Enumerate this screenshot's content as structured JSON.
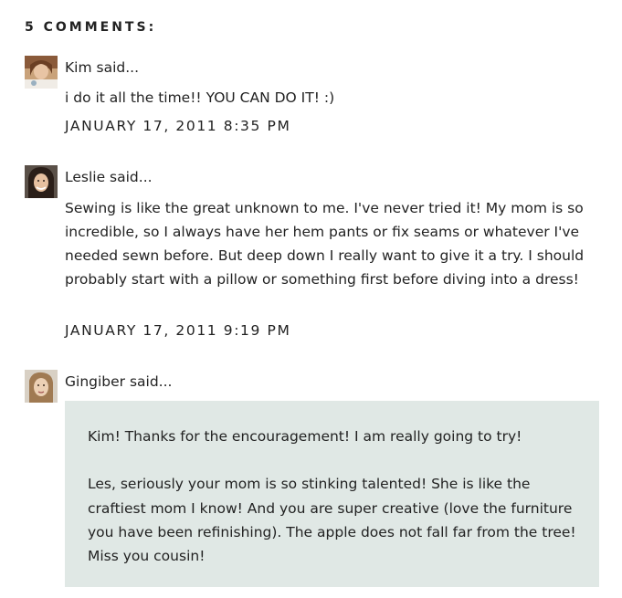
{
  "comments_header": "5 COMMENTS:",
  "comments": [
    {
      "author_line": "Kim said...",
      "text": "i do it all the time!! YOU CAN DO IT! :)",
      "timestamp": "JANUARY 17, 2011 8:35 PM"
    },
    {
      "author_line": "Leslie said...",
      "text": "Sewing is like the great unknown to me. I've never tried it! My mom is so incredible, so I always have her hem pants or fix seams or whatever I've needed sewn before. But deep down I really want to give it a try. I should probably start with a pillow or something first before diving into a dress!",
      "timestamp": "JANUARY 17, 2011 9:19 PM"
    },
    {
      "author_line": "Gingiber said...",
      "paragraphs": [
        "Kim! Thanks for the encouragement! I am really going to try!",
        "Les, seriously your mom is so stinking talented! She is like the craftiest mom I know! And you are super creative (love the furniture you have been refinishing). The apple does not fall far from the tree! Miss you cousin!"
      ]
    }
  ],
  "colors": {
    "text": "#222222",
    "author_highlight_bg": "#e0e8e5"
  },
  "icons": [
    "avatar-kim",
    "avatar-leslie",
    "avatar-gingiber"
  ]
}
